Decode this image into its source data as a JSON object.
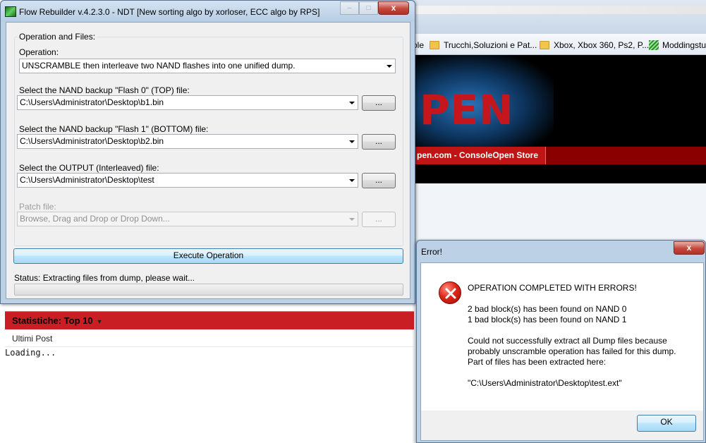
{
  "background_browser": {
    "bookmarks": [
      {
        "label": "ole",
        "icon": "none"
      },
      {
        "label": "Trucchi,Soluzioni e Pat...",
        "icon": "folder-icon"
      },
      {
        "label": "Xbox, Xbox 360, Ps2, P...",
        "icon": "folder-icon"
      },
      {
        "label": "Moddingstu",
        "icon": "site-icon"
      }
    ],
    "banner_logo": "PEN",
    "nav_item": "pen.com - ConsoleOpen Store",
    "stats_title": "Statistiche: Top 10",
    "stats_caret": "▼",
    "ultimi_post": "Ultimi Post",
    "loading": "Loading..."
  },
  "main_window": {
    "title": "Flow Rebuilder v.4.2.3.0 - NDT [New sorting algo by xorloser, ECC algo by RPS]",
    "caption_buttons": {
      "minimize": "–",
      "maximize": "□",
      "close": "x"
    },
    "group_label": "Operation and Files:",
    "operation_label": "Operation:",
    "operation_value": "UNSCRAMBLE then interleave two NAND flashes into one unified dump.",
    "flash0_label": "Select the NAND backup \"Flash 0\" (TOP) file:",
    "flash0_value": "C:\\Users\\Administrator\\Desktop\\b1.bin",
    "flash1_label": "Select the NAND backup \"Flash 1\" (BOTTOM) file:",
    "flash1_value": "C:\\Users\\Administrator\\Desktop\\b2.bin",
    "output_label": "Select the OUTPUT (Interleaved) file:",
    "output_value": "C:\\Users\\Administrator\\Desktop\\test",
    "patch_label": "Patch file:",
    "patch_placeholder": "Browse, Drag and Drop or Drop Down...",
    "browse_label": "...",
    "execute_label": "Execute Operation",
    "status_text": "Status: Extracting files from dump, please wait...",
    "progress": 0
  },
  "error_dialog": {
    "title": "Error!",
    "close": "x",
    "heading": "OPERATION COMPLETED WITH ERRORS!",
    "line1": "2 bad block(s) has been found on NAND 0",
    "line2": "1 bad block(s) has been found on NAND 1",
    "para1": "Could not successfully extract all Dump files because",
    "para2": "probably unscramble operation has failed for this dump.",
    "para3": "Part of files has been extracted here:",
    "path": "\"C:\\Users\\Administrator\\Desktop\\test.ext\"",
    "ok_label": "OK"
  },
  "colors": {
    "accent_red": "#c81e24",
    "window_frame": "#bcd1e6",
    "error_icon": "#e0261a"
  }
}
